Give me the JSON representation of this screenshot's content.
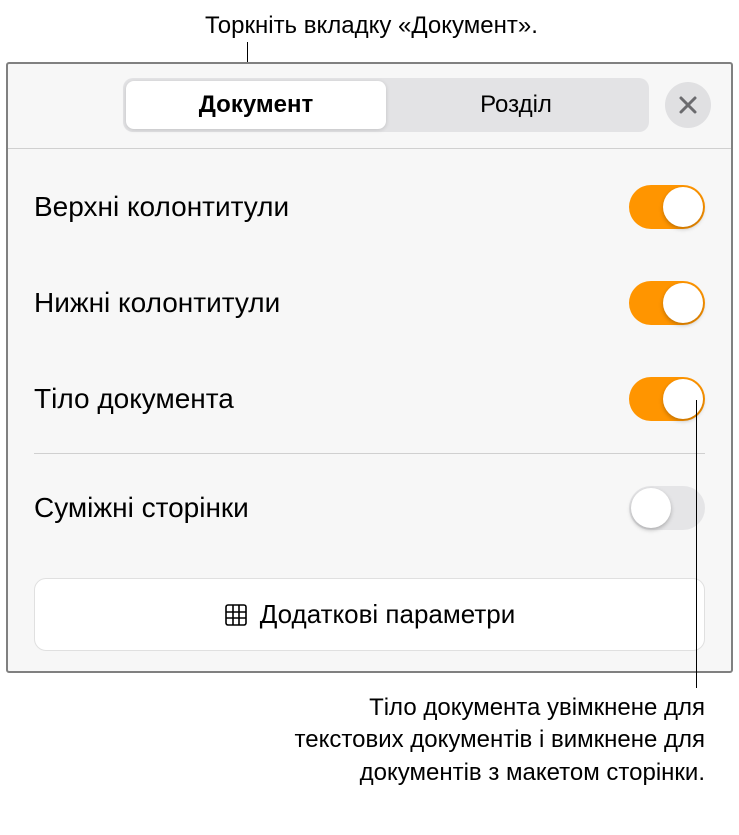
{
  "callouts": {
    "top": "Торкніть вкладку «Документ».",
    "bottom": "Тіло документа увімкнене для текстових документів і вимкнене для документів з макетом сторінки."
  },
  "tabs": {
    "document": "Документ",
    "section": "Розділ"
  },
  "settings": {
    "headers": {
      "label": "Верхні колонтитули",
      "on": true
    },
    "footers": {
      "label": "Нижні колонтитули",
      "on": true
    },
    "body": {
      "label": "Тіло документа",
      "on": true
    },
    "facing": {
      "label": "Суміжні сторінки",
      "on": false
    }
  },
  "more_button": "Додаткові параметри"
}
